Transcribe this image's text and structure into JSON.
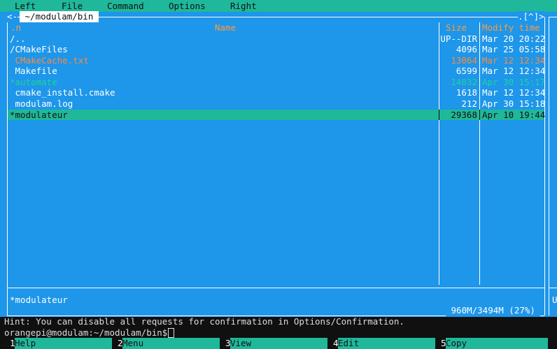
{
  "menu": [
    "Left",
    "File",
    "Command",
    "Options",
    "Right"
  ],
  "panel": {
    "left_corner": "<-",
    "path": " ~/modulam/bin ",
    "top_right": ".[^]>",
    "col_n": ".n",
    "col_name": "Name",
    "col_size": "Size",
    "col_mtime": "Modify time",
    "rows": [
      {
        "name": "/..",
        "size": "UP--DIR",
        "mtime": "Mar 20 20:22",
        "color": "white"
      },
      {
        "name": "/CMakeFiles",
        "size": "4096",
        "mtime": "Mar 25 05:58",
        "color": "white"
      },
      {
        "name": " CMakeCache.txt",
        "size": "13064",
        "mtime": "Mar 12 12:34",
        "color": "orange"
      },
      {
        "name": " Makefile",
        "size": "6599",
        "mtime": "Mar 12 12:34",
        "color": "white"
      },
      {
        "name": "*automate",
        "size": "14032",
        "mtime": "Apr 30 15:17",
        "color": "green"
      },
      {
        "name": " cmake_install.cmake",
        "size": "1618",
        "mtime": "Mar 12 12:34",
        "color": "white"
      },
      {
        "name": " modulam.log",
        "size": "212",
        "mtime": "Apr 30 15:18",
        "color": "white"
      },
      {
        "name": "*modulateur",
        "size": "29368",
        "mtime": "Apr 10 19:44",
        "color": "selected"
      }
    ],
    "mini_status": "*modulateur",
    "disk_free": " 960M/3494M (27%) "
  },
  "right_panel_letter": "U",
  "hint": "Hint: You can disable all requests for confirmation in Options/Confirmation.",
  "prompt": "orangepi@modulam:~/modulam/bin$",
  "fkeys": [
    {
      "num": "1",
      "label": "Help"
    },
    {
      "num": "2",
      "label": "Menu"
    },
    {
      "num": "3",
      "label": "View"
    },
    {
      "num": "4",
      "label": "Edit"
    },
    {
      "num": "5",
      "label": "Copy"
    }
  ],
  "colors": {
    "panel": "#1e96ea",
    "accent": "#1fb89a",
    "header": "#ff9a3c",
    "exec": "#1fd39a",
    "orange": "#ff8a3a"
  }
}
